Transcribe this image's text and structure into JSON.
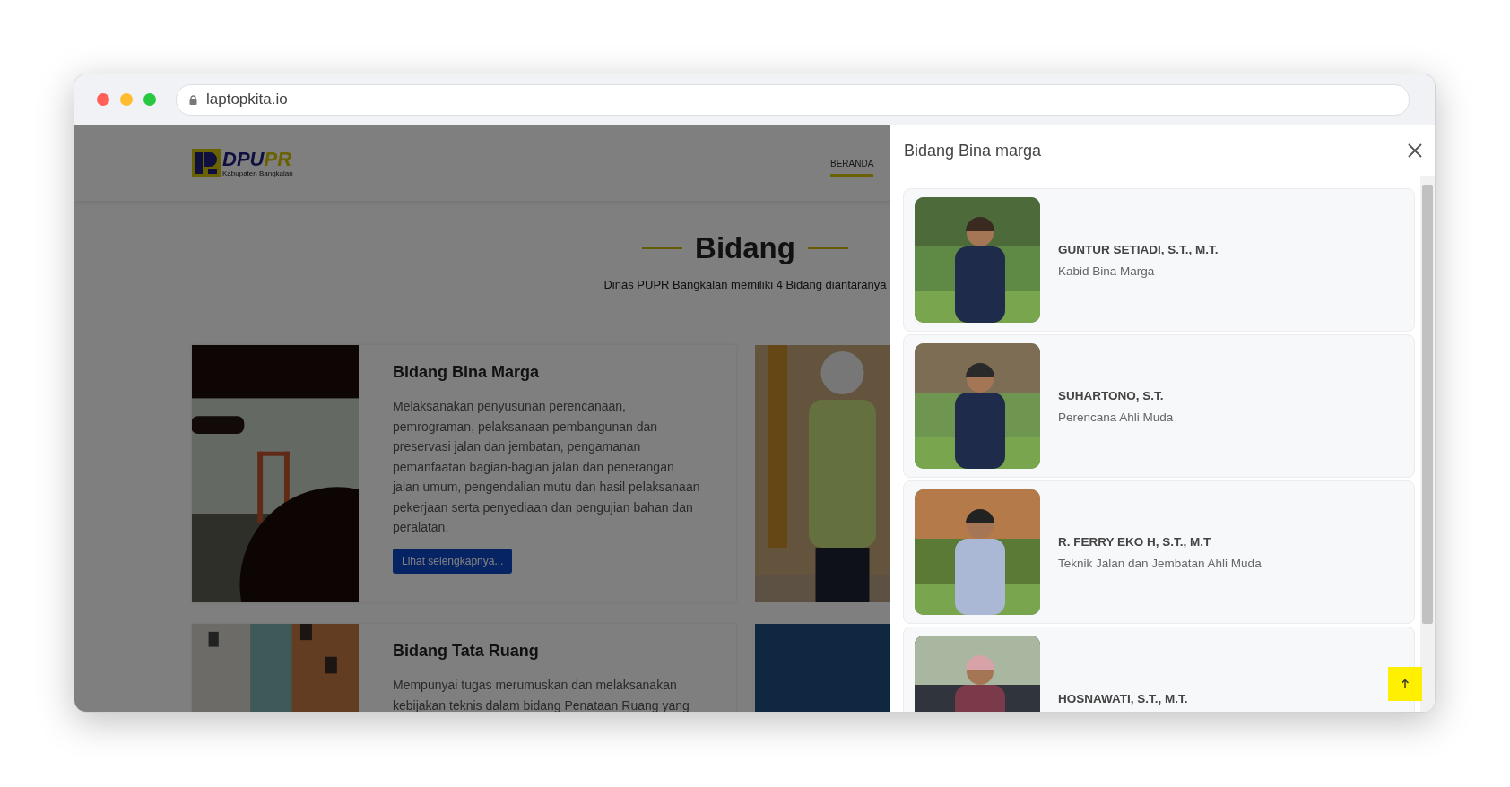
{
  "browser": {
    "url": "laptopkita.io"
  },
  "page": {
    "wordmark": [
      {
        "text": "DPU"
      },
      {
        "text": "PR"
      }
    ],
    "logo_caption": "Kabupaten Bangkalan",
    "nav": [
      {
        "label": "BERANDA",
        "selected": true
      }
    ],
    "section": {
      "title": "Bidang",
      "subtitle": "Dinas PUPR Bangkalan memiliki 4 Bidang diantaranya"
    },
    "cards": [
      {
        "title": "Bidang Bina Marga",
        "description": "Melaksanakan penyusunan perencanaan, pemrograman, pelaksanaan pembangunan dan preservasi jalan dan jembatan, pengamanan pemanfaatan bagian-bagian jalan dan penerangan jalan umum, pengendalian mutu dan hasil pelaksanaan pekerjaan serta penyediaan dan pengujian bahan dan peralatan.",
        "button": "Lihat selengkapnya..."
      },
      {
        "title": "Bidang Tata Ruang",
        "description": "Mempunyai tugas merumuskan dan melaksanakan kebijakan teknis dalam bidang Penataan Ruang yang"
      }
    ]
  },
  "drawer": {
    "title": "Bidang Bina marga",
    "people": [
      {
        "name": "GUNTUR SETIADI, S.T., M.T.",
        "role": "Kabid Bina Marga"
      },
      {
        "name": "SUHARTONO, S.T.",
        "role": "Perencana Ahli Muda"
      },
      {
        "name": "R. FERRY EKO H, S.T., M.T",
        "role": "Teknik Jalan dan Jembatan Ahli Muda"
      },
      {
        "name": "HOSNAWATI, S.T., M.T."
      }
    ]
  }
}
